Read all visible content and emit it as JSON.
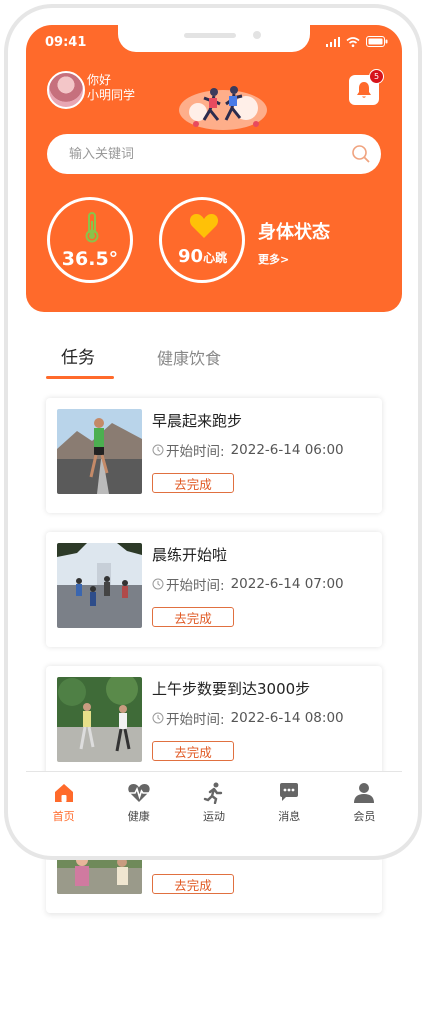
{
  "status_bar": {
    "time": "09:41"
  },
  "user": {
    "greeting": "你好",
    "name": "小明同学"
  },
  "notifications": {
    "count": "5"
  },
  "search": {
    "placeholder": "输入关键词"
  },
  "metrics": {
    "temperature": "36.5°",
    "heart_rate": "90",
    "heart_rate_unit": "心跳",
    "body_status": "身体状态",
    "more": "更多>"
  },
  "tabs": [
    {
      "label": "任务",
      "active": true
    },
    {
      "label": "健康饮食",
      "active": false
    }
  ],
  "tasks": [
    {
      "title": "早晨起来跑步",
      "time_label": "开始时间:",
      "time": "2022-6-14 06:00",
      "action": "去完成"
    },
    {
      "title": "晨练开始啦",
      "time_label": "开始时间:",
      "time": "2022-6-14 07:00",
      "action": "去完成"
    },
    {
      "title": "上午步数要到达3000步",
      "time_label": "开始时间:",
      "time": "2022-6-14 08:00",
      "action": "去完成"
    },
    {
      "action": "去完成"
    }
  ],
  "bottom_nav": [
    {
      "label": "首页",
      "icon": "home-icon",
      "active": true
    },
    {
      "label": "健康",
      "icon": "heartbeat-icon",
      "active": false
    },
    {
      "label": "运动",
      "icon": "running-icon",
      "active": false
    },
    {
      "label": "消息",
      "icon": "chat-icon",
      "active": false
    },
    {
      "label": "会员",
      "icon": "user-icon",
      "active": false
    }
  ],
  "colors": {
    "accent": "#ff6a2b",
    "heart": "#ffc107",
    "thermometer": "#8bc34a",
    "badge": "#d6141b"
  }
}
